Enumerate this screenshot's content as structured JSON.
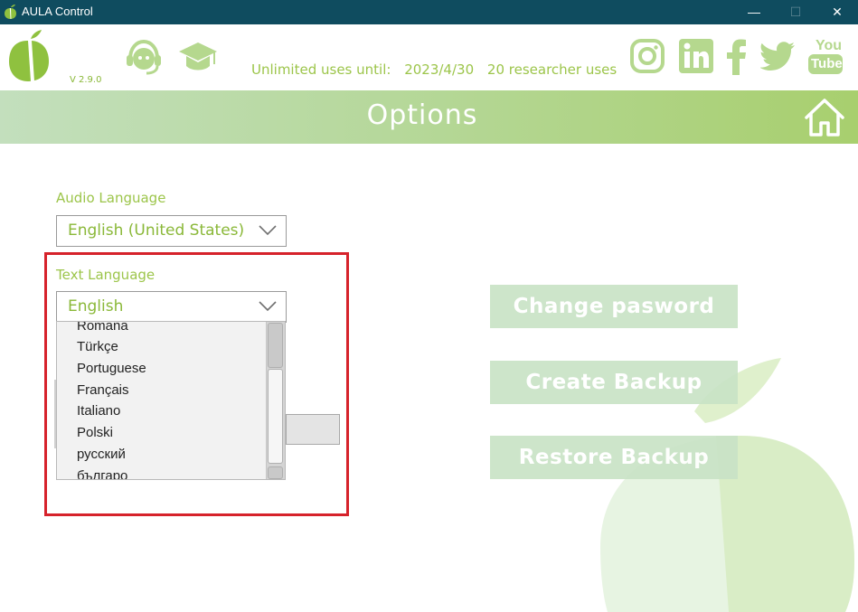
{
  "window": {
    "title": "AULA Control",
    "minimize": "—",
    "maximize": "☐",
    "close": "✕"
  },
  "header": {
    "version": "V 2.9.0",
    "licence_until_label": "Unlimited uses until:",
    "licence_until_date": "2023/4/30",
    "researcher_uses": "20 researcher uses",
    "icons": [
      "headset-icon",
      "graduation-cap-icon"
    ],
    "social_icons": [
      "instagram-icon",
      "linkedin-icon",
      "facebook-icon",
      "twitter-icon",
      "youtube-icon"
    ],
    "youtube_top": "You",
    "youtube_bottom": "Tube"
  },
  "banner": {
    "title": "Options"
  },
  "audio_language": {
    "label": "Audio Language",
    "value": "English (United States)"
  },
  "text_language": {
    "label": "Text Language",
    "value": "English",
    "options": [
      "Romana",
      "Türkçe",
      "Portuguese",
      "Français",
      "Italiano",
      "Polski",
      "русский",
      "българо"
    ]
  },
  "buttons": {
    "change_password": "Change pasword",
    "create_backup": "Create Backup",
    "restore_backup": "Restore Backup"
  },
  "colors": {
    "titlebar": "#0f4c5f",
    "accent_green": "#9cc54a",
    "banner_start": "#c3dfbd",
    "banner_end": "#a8cf6e",
    "button": "#c9e3c6",
    "highlight": "#d6222b"
  }
}
